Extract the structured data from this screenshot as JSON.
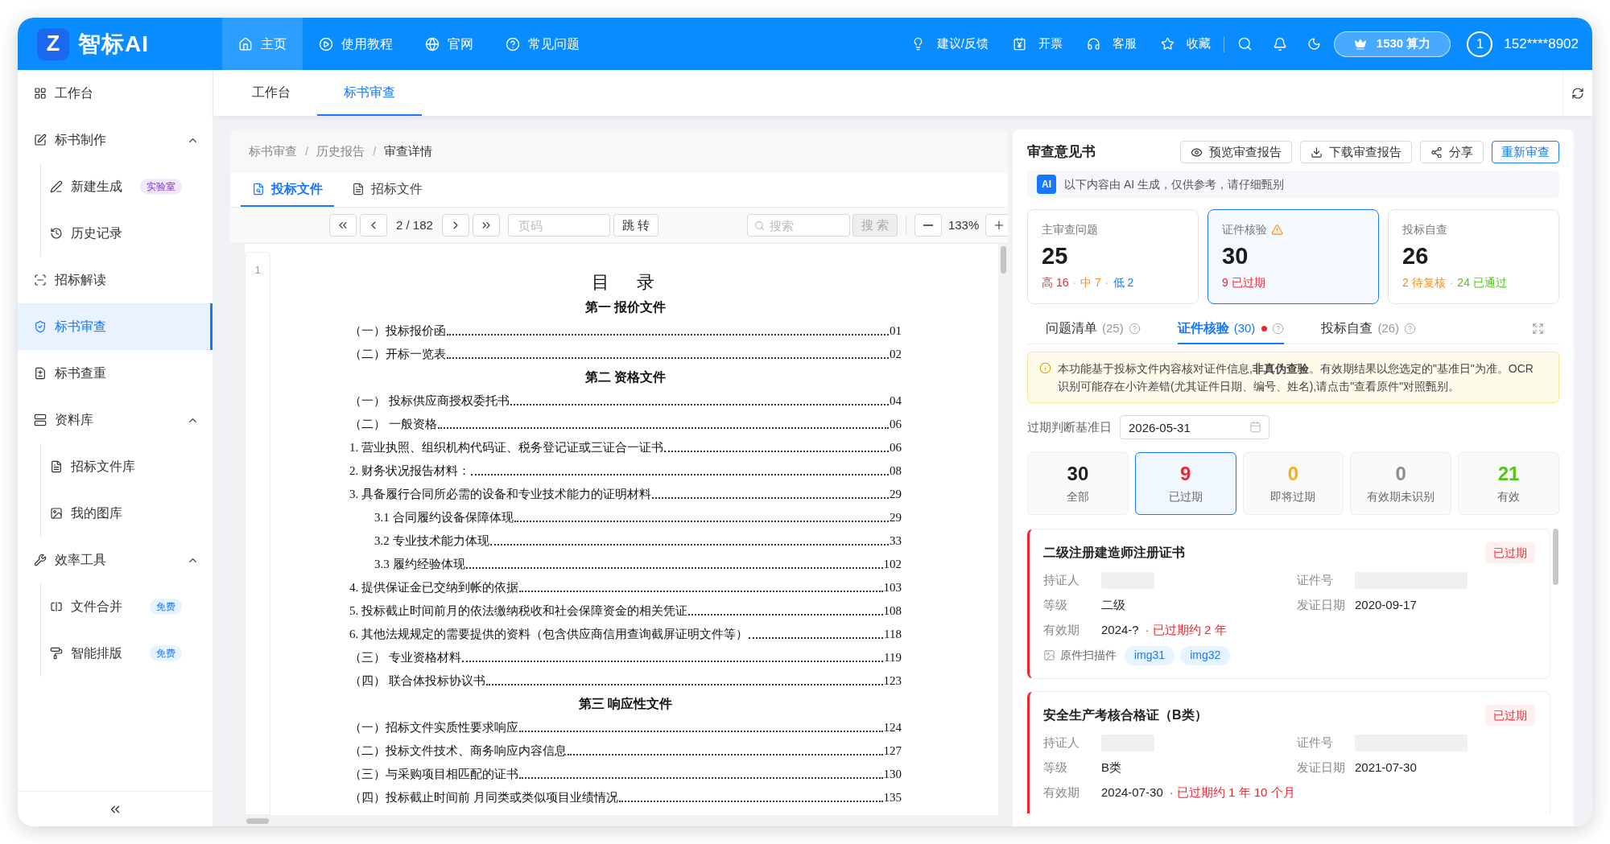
{
  "top_bar": {
    "logo_mark": "Z",
    "logo_name": "智标AI",
    "nav": [
      {
        "label": "主页",
        "selected": true
      },
      {
        "label": "使用教程",
        "selected": false
      },
      {
        "label": "官网",
        "selected": false
      },
      {
        "label": "常见问题",
        "selected": false
      }
    ],
    "actions": [
      "建议/反馈",
      "开票",
      "客服",
      "收藏"
    ],
    "credits": "1530 算力",
    "avatar": "1",
    "user": "152****8902"
  },
  "sidebar": {
    "items": [
      {
        "label": "工作台",
        "selected": false
      },
      {
        "label": "标书制作",
        "selected": false,
        "expanded": true,
        "children": [
          {
            "label": "新建生成",
            "selected": false,
            "badge": {
              "text": "实验室",
              "kind": "lab"
            }
          },
          {
            "label": "历史记录",
            "selected": false
          }
        ]
      },
      {
        "label": "招标解读",
        "selected": false
      },
      {
        "label": "标书审查",
        "selected": true
      },
      {
        "label": "标书查重",
        "selected": false
      },
      {
        "label": "资料库",
        "selected": false,
        "expanded": true,
        "children": [
          {
            "label": "招标文件库",
            "selected": false
          },
          {
            "label": "我的图库",
            "selected": false
          }
        ]
      },
      {
        "label": "效率工具",
        "selected": false,
        "expanded": true,
        "children": [
          {
            "label": "文件合并",
            "selected": false,
            "badge": {
              "text": "免费",
              "kind": "free"
            }
          },
          {
            "label": "智能排版",
            "selected": false,
            "badge": {
              "text": "免费",
              "kind": "free"
            }
          }
        ]
      }
    ]
  },
  "page_tabs": [
    {
      "label": "工作台",
      "selected": false
    },
    {
      "label": "标书审查",
      "selected": true
    }
  ],
  "document": {
    "breadcrumb": [
      "标书审查",
      "历史报告",
      "审查详情"
    ],
    "breadcrumb_separator": "/",
    "tabs": [
      {
        "label": "投标文件",
        "selected": true
      },
      {
        "label": "招标文件",
        "selected": false
      }
    ],
    "toolbar": {
      "page": "2 / 182",
      "page_placeholder": "页码",
      "jump": "跳 转",
      "search_placeholder": "搜索",
      "search_button": "搜 索",
      "search_disabled": true,
      "zoom": "133%"
    },
    "line_number": "1",
    "toc": {
      "title": "目　录",
      "sections": [
        {
          "heading": "第一 报价文件",
          "entries": [
            {
              "text": "（一）投标报价函",
              "page": "01"
            },
            {
              "text": "（二）开标一览表",
              "page": "02"
            }
          ]
        },
        {
          "heading": "第二 资格文件",
          "entries": [
            {
              "text": "（一） 投标供应商授权委托书",
              "page": "04"
            },
            {
              "text": "（二） 一般资格",
              "page": "06"
            },
            {
              "text": "1. 营业执照、组织机构代码证、税务登记证或三证合一证书",
              "page": "06"
            },
            {
              "text": "2. 财务状况报告材料：",
              "page": "08"
            },
            {
              "text": "3. 具备履行合同所必需的设备和专业技术能力的证明材料",
              "page": "29",
              "children": [
                {
                  "text": "3.1 合同履约设备保障体现",
                  "page": "29"
                },
                {
                  "text": "3.2 专业技术能力体现",
                  "page": "33"
                },
                {
                  "text": "3.3 履约经验体现",
                  "page": "102"
                }
              ]
            },
            {
              "text": "4. 提供保证金已交纳到帐的依据",
              "page": "103"
            },
            {
              "text": "5. 投标截止时间前月的依法缴纳税收和社会保障资金的相关凭证",
              "page": "108"
            },
            {
              "text": "6. 其他法规规定的需要提供的资料（包含供应商信用查询截屏证明文件等）",
              "page": "118"
            },
            {
              "text": "（三） 专业资格材料",
              "page": "119"
            },
            {
              "text": "（四） 联合体投标协议书",
              "page": "123"
            }
          ]
        },
        {
          "heading": "第三 响应性文件",
          "entries": [
            {
              "text": "（一）招标文件实质性要求响应",
              "page": "124"
            },
            {
              "text": "（二）投标文件技术、商务响应内容信息",
              "page": "127"
            },
            {
              "text": "（三）与采购项目相匹配的证书",
              "page": "130"
            },
            {
              "text": "（四）投标截止时间前 月同类或类似项目业绩情况",
              "page": "135"
            }
          ]
        }
      ]
    }
  },
  "review": {
    "title": "审查意见书",
    "actions": [
      {
        "label": "预览审查报告",
        "kind": "default"
      },
      {
        "label": "下载审查报告",
        "kind": "default"
      },
      {
        "label": "分享",
        "kind": "default"
      },
      {
        "label": "重新审查",
        "kind": "primary"
      }
    ],
    "ai_notice": {
      "badge": "AI",
      "text": "以下内容由 AI 生成，仅供参考，请仔细甄别"
    },
    "separator": "·",
    "stat_cards": [
      {
        "label": "主审查问题",
        "value": "25",
        "selected": false,
        "warning": false,
        "breakdown": [
          {
            "text": "高 16",
            "color": "#f5222d"
          },
          {
            "text": "中 7",
            "color": "#fa8c16"
          },
          {
            "text": "低 2",
            "color": "#1677ff"
          }
        ]
      },
      {
        "label": "证件核验",
        "value": "30",
        "selected": true,
        "warning": true,
        "breakdown": [
          {
            "text": "9 已过期",
            "color": "#f5222d"
          }
        ]
      },
      {
        "label": "投标自查",
        "value": "26",
        "selected": false,
        "warning": false,
        "breakdown": [
          {
            "text": "2 待复核",
            "color": "#fa8c16"
          },
          {
            "text": "24 已通过",
            "color": "#52c41a"
          }
        ]
      }
    ],
    "tabs": [
      {
        "label": "问题清单",
        "count": "(25)",
        "selected": false,
        "alert": false
      },
      {
        "label": "证件核验",
        "count": "(30)",
        "selected": true,
        "alert": true
      },
      {
        "label": "投标自查",
        "count": "(26)",
        "selected": false,
        "alert": false
      }
    ],
    "notice": "本功能基于投标文件内容核对证件信息,**非真伪查验**。有效期结果以您选定的\"基准日\"为准。OCR识别可能存在小许差错(尤其证件日期、编号、姓名),请点击\"查看原件\"对照甄别。",
    "date_filter": {
      "label": "过期判断基准日",
      "value": "2026-05-31"
    },
    "filters": [
      {
        "count": "30",
        "label": "全部",
        "color": "#1f1f1f",
        "selected": false
      },
      {
        "count": "9",
        "label": "已过期",
        "color": "#f5222d",
        "selected": true
      },
      {
        "count": "0",
        "label": "即将过期",
        "color": "#faad14",
        "selected": false
      },
      {
        "count": "0",
        "label": "有效期未识别",
        "color": "#8c8c8c",
        "selected": false
      },
      {
        "count": "21",
        "label": "有效",
        "color": "#52c41a",
        "selected": false
      }
    ],
    "certificates": [
      {
        "title": "二级注册建造师注册证书",
        "status": "已过期",
        "kind": "expired",
        "fields": [
          {
            "label": "持证人",
            "kind": "redacted"
          },
          {
            "label": "证件号",
            "kind": "redacted"
          },
          {
            "label": "等级",
            "kind": "text",
            "value": "二级"
          },
          {
            "label": "发证日期",
            "kind": "text",
            "value": "2020-09-17"
          },
          {
            "label": "有效期",
            "kind": "text",
            "value": "2024-?",
            "note": "· 已过期约 2 年"
          }
        ],
        "scans": {
          "label": "原件扫描件",
          "files": [
            "img31",
            "img32"
          ]
        }
      },
      {
        "title": "安全生产考核合格证（B类）",
        "status": "已过期",
        "kind": "expired",
        "fields": [
          {
            "label": "持证人",
            "kind": "redacted"
          },
          {
            "label": "证件号",
            "kind": "redacted"
          },
          {
            "label": "等级",
            "kind": "text",
            "value": "B类"
          },
          {
            "label": "发证日期",
            "kind": "text",
            "value": "2021-07-30"
          },
          {
            "label": "有效期",
            "kind": "text",
            "value": "2024-07-30",
            "note": "· 已过期约 1 年 10 个月"
          }
        ]
      }
    ]
  }
}
